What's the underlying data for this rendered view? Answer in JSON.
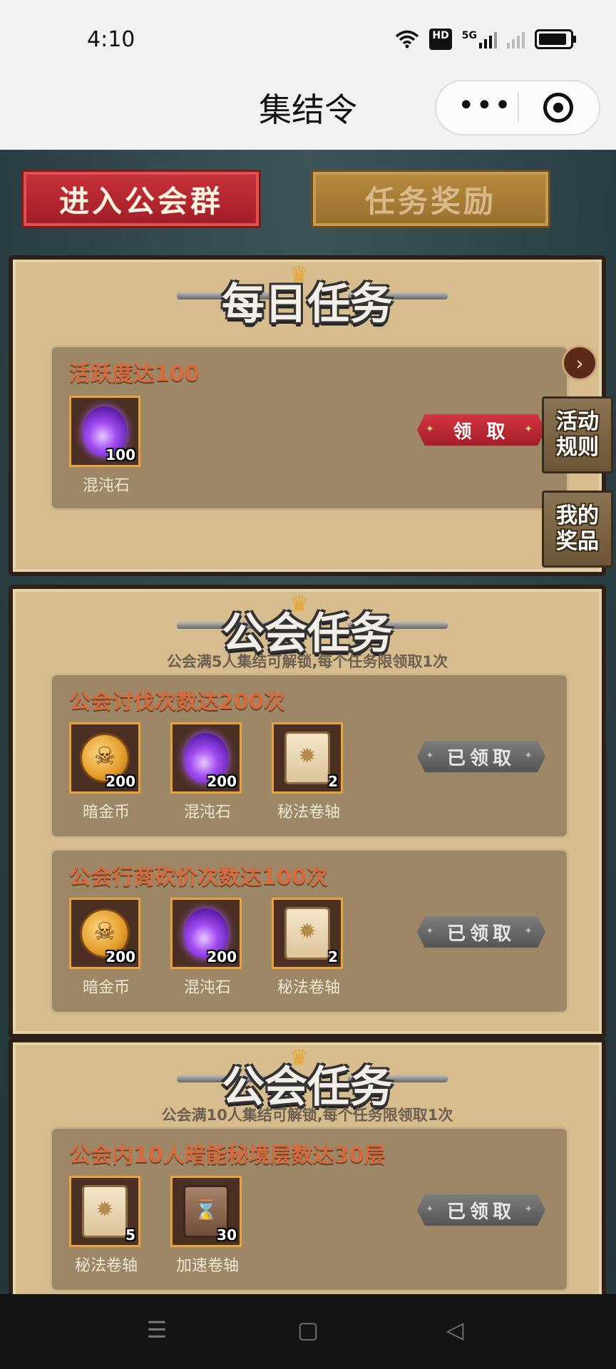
{
  "status_bar": {
    "time": "4:10",
    "network_badge": "HD",
    "signal_label": "5G"
  },
  "title_bar": {
    "title": "集结令",
    "more_icon": "more-dots-icon",
    "target_icon": "record-target-icon"
  },
  "top_buttons": {
    "enter_guild": "进入公会群",
    "task_reward": "任务奖励"
  },
  "side_buttons": {
    "activity_rules": "活动\n规则",
    "my_prizes": "我的\n奖品"
  },
  "daily": {
    "title": "每日任务",
    "tasks": [
      {
        "title": "活跃度达100",
        "items": [
          {
            "name": "混沌石",
            "qty": "100",
            "icon": "chaos-stone-icon"
          }
        ],
        "action": "领 取"
      }
    ]
  },
  "guild5": {
    "title": "公会任务",
    "subtitle": "公会满5人集结可解锁,每个任务限领取1次",
    "tasks": [
      {
        "title": "公会讨伐次数达200次",
        "items": [
          {
            "name": "暗金币",
            "qty": "200",
            "icon": "dark-gold-coin-icon"
          },
          {
            "name": "混沌石",
            "qty": "200",
            "icon": "chaos-stone-icon"
          },
          {
            "name": "秘法卷轴",
            "qty": "2",
            "icon": "arcane-scroll-icon"
          }
        ],
        "action": "已领取"
      },
      {
        "title": "公会行商砍价次数达100次",
        "items": [
          {
            "name": "暗金币",
            "qty": "200",
            "icon": "dark-gold-coin-icon"
          },
          {
            "name": "混沌石",
            "qty": "200",
            "icon": "chaos-stone-icon"
          },
          {
            "name": "秘法卷轴",
            "qty": "2",
            "icon": "arcane-scroll-icon"
          }
        ],
        "action": "已领取"
      }
    ]
  },
  "guild10": {
    "title": "公会任务",
    "subtitle": "公会满10人集结可解锁,每个任务限领取1次",
    "tasks": [
      {
        "title": "公会内10人暗能秘境层数达30层",
        "items": [
          {
            "name": "秘法卷轴",
            "qty": "5",
            "icon": "arcane-scroll-icon"
          },
          {
            "name": "加速卷轴",
            "qty": "30",
            "icon": "speed-scroll-icon"
          }
        ],
        "action": "已领取"
      }
    ]
  },
  "nav": {
    "menu_icon": "menu-icon",
    "home_icon": "home-square-icon",
    "back_icon": "back-triangle-icon"
  }
}
